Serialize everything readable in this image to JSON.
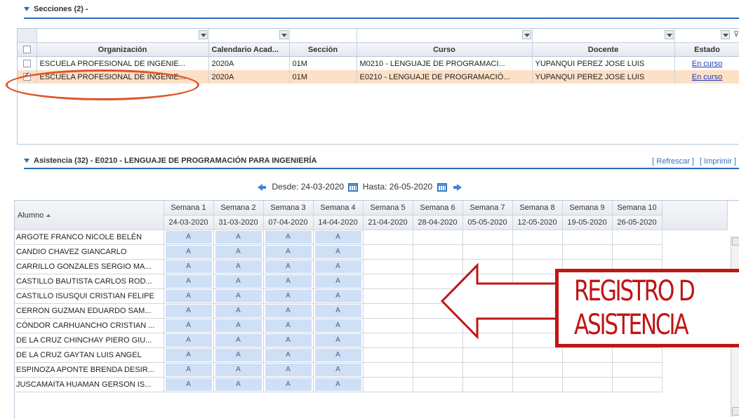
{
  "sections": {
    "title": "Secciones (2) -",
    "columns": [
      "Organización",
      "Calendario Acad...",
      "Sección",
      "Curso",
      "Docente",
      "Estado"
    ],
    "rows": [
      {
        "org": "ESCUELA PROFESIONAL DE INGENIE...",
        "cal": "2020A",
        "sec": "01M",
        "curso": "M0210 - LENGUAJE DE PROGRAMACI...",
        "docente": "YUPANQUI PEREZ JOSE LUIS",
        "estado": "En curso",
        "checked": false
      },
      {
        "org": "ESCUELA PROFESIONAL DE INGENIE...",
        "cal": "2020A",
        "sec": "01M",
        "curso": "E0210 - LENGUAJE DE PROGRAMACIÓ...",
        "docente": "YUPANQUI PEREZ JOSE LUIS",
        "estado": "En curso",
        "checked": true
      }
    ]
  },
  "attendance": {
    "title": "Asistencia (32) - E0210 - LENGUAJE DE PROGRAMACIÓN PARA INGENIERÍA",
    "refresh": "[ Refrescar ]",
    "print": "[ Imprimir ]",
    "desde": "Desde: 24-03-2020",
    "hasta": "Hasta: 26-05-2020",
    "student_header": "Alumno",
    "weeks": [
      {
        "label": "Semana 1",
        "date": "24-03-2020"
      },
      {
        "label": "Semana 2",
        "date": "31-03-2020"
      },
      {
        "label": "Semana 3",
        "date": "07-04-2020"
      },
      {
        "label": "Semana 4",
        "date": "14-04-2020"
      },
      {
        "label": "Semana 5",
        "date": "21-04-2020"
      },
      {
        "label": "Semana 6",
        "date": "28-04-2020"
      },
      {
        "label": "Semana 7",
        "date": "05-05-2020"
      },
      {
        "label": "Semana 8",
        "date": "12-05-2020"
      },
      {
        "label": "Semana 9",
        "date": "19-05-2020"
      },
      {
        "label": "Semana 10",
        "date": "26-05-2020"
      }
    ],
    "mark": "A",
    "marked_weeks": 4,
    "students": [
      "ARGOTE FRANCO NICOLE BELÉN",
      "CANDIO CHAVEZ GIANCARLO",
      "CARRILLO GONZALES SERGIO MA...",
      "CASTILLO BAUTISTA CARLOS ROD...",
      "CASTILLO ISUSQUI CRISTIAN FELIPE",
      "CERRON GUZMAN EDUARDO SAM...",
      "CÓNDOR CARHUANCHO CRISTIAN ...",
      "DE LA CRUZ CHINCHAY PIERO GIU...",
      "DE LA CRUZ GAYTAN LUIS ANGEL",
      "ESPINOZA APONTE BRENDA DESIR...",
      "JUSCAMAITA HUAMAN GERSON IS..."
    ]
  },
  "overlay": {
    "line1": "REGISTRO D",
    "line2": "ASISTENCIA",
    "color": "#c01515"
  }
}
